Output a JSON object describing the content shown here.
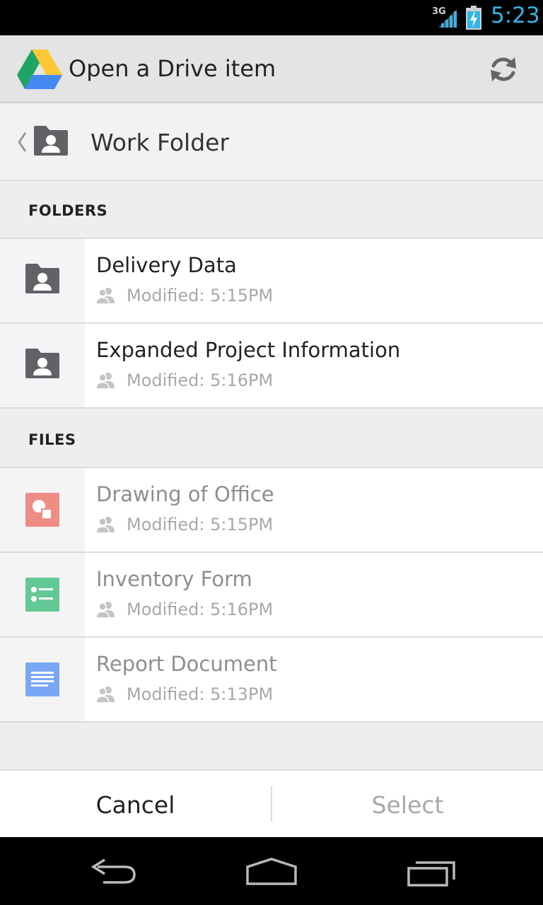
{
  "status_bar": {
    "network": "3G",
    "time": "5:23"
  },
  "header": {
    "title": "Open a Drive item"
  },
  "breadcrumb": {
    "folder_name": "Work Folder"
  },
  "sections": {
    "folders_label": "FOLDERS",
    "files_label": "FILES"
  },
  "folders": [
    {
      "name": "Delivery Data",
      "modified": "Modified: 5:15PM"
    },
    {
      "name": "Expanded Project Information",
      "modified": "Modified: 5:16PM"
    }
  ],
  "files": [
    {
      "name": "Drawing of Office",
      "modified": "Modified: 5:15PM",
      "type": "drawing",
      "color": "#ef8d84"
    },
    {
      "name": "Inventory Form",
      "modified": "Modified: 5:16PM",
      "type": "form",
      "color": "#62c894"
    },
    {
      "name": "Report Document",
      "modified": "Modified: 5:13PM",
      "type": "document",
      "color": "#7aa7f3"
    }
  ],
  "actions": {
    "cancel": "Cancel",
    "select": "Select"
  },
  "colors": {
    "accent_clock": "#33b5e5",
    "folder_icon": "#616166"
  },
  "icons": {
    "network": "signal-icon",
    "battery": "battery-charging-icon",
    "app": "google-drive-logo",
    "refresh": "refresh-icon",
    "back": "chevron-left-icon",
    "shared": "shared-people-icon",
    "nav_back": "back-arrow-icon",
    "nav_home": "home-icon",
    "nav_recents": "recent-apps-icon"
  }
}
